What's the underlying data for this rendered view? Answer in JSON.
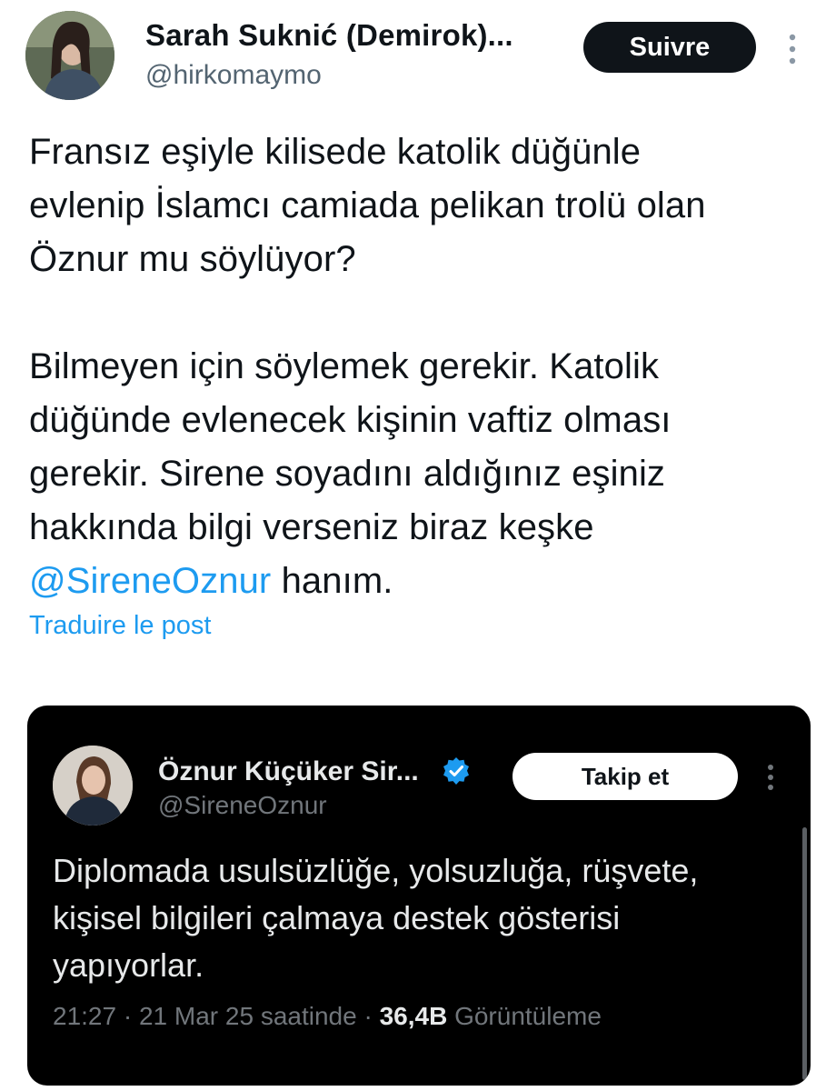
{
  "author": {
    "name": "Sarah Suknić (Demirok)...",
    "handle": "@hirkomaymo",
    "avatar_icon": "profile-photo"
  },
  "follow_label": "Suivre",
  "more_icon": "more-vertical-icon",
  "tweet": {
    "line1": "Fransız eşiyle kilisede katolik düğünle\nevlenip İslamcı camiada pelikan trolü olan\nÖznur mu söylüyor?\n\nBilmeyen için söylemek gerekir. Katolik\ndüğünde evlenecek kişinin vaftiz olması\ngerekir. Sirene soyadını aldığınız eşiniz\nhakkında bilgi verseniz biraz keşke\n",
    "mention": "@SireneOznur",
    "tail": " hanım."
  },
  "translate_label": "Traduire le post",
  "quoted": {
    "name": "Öznur Küçüker Sir...",
    "handle": "@SireneOznur",
    "verified_icon": "verified-badge-icon",
    "follow_label": "Takip et",
    "text": "Diplomada usulsüzlüğe, yolsuzluğa, rüşvete,\nkişisel bilgileri çalmaya destek gösterisi\nyapıyorlar.",
    "time": "21:27",
    "sep1": " · ",
    "date": "21 Mar 25 saatinde",
    "sep2": " · ",
    "views": "36,4B",
    "views_label": " Görüntüleme"
  },
  "colors": {
    "accent": "#1d9bf0",
    "text": "#0f1419",
    "secondary": "#536471",
    "dark_bg": "#000000"
  }
}
